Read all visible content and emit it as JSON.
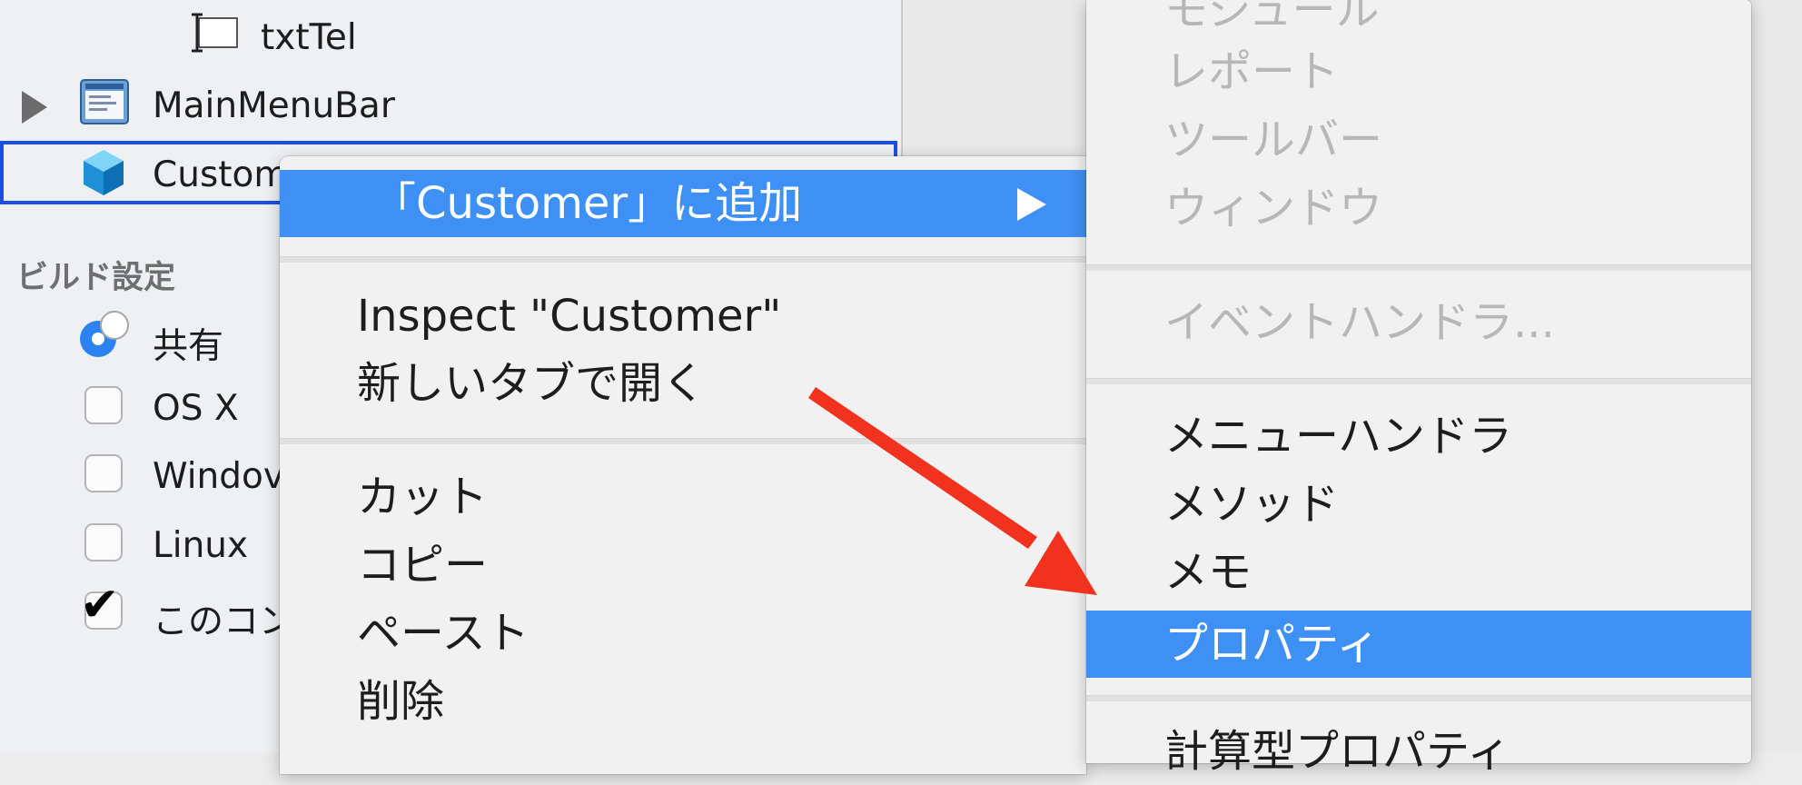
{
  "sidebar": {
    "tree": [
      {
        "label": "txtTel"
      },
      {
        "label": "MainMenuBar"
      },
      {
        "label": "Custom"
      }
    ],
    "build_settings": {
      "title": "ビルド設定",
      "shared_label": "共有",
      "targets": [
        {
          "label": "OS X",
          "checked": false
        },
        {
          "label": "Windov",
          "checked": false
        },
        {
          "label": "Linux",
          "checked": false
        },
        {
          "label": "このコン",
          "checked": true
        }
      ]
    }
  },
  "context_menu": {
    "add_to": "「Customer」に追加",
    "inspect": "Inspect \"Customer\"",
    "open_new_tab": "新しいタブで開く",
    "cut": "カット",
    "copy": "コピー",
    "paste": "ペースト",
    "delete": "削除"
  },
  "submenu": {
    "module": "モジュール",
    "report": "レポート",
    "toolbar": "ツールバー",
    "window": "ウィンドウ",
    "event_handler": "イベントハンドラ...",
    "menu_handler": "メニューハンドラ",
    "method": "メソッド",
    "note": "メモ",
    "property": "プロパティ",
    "computed_property": "計算型プロパティ"
  },
  "colors": {
    "highlight": "#3f90f5",
    "selection_border": "#1a50e6",
    "annotation_arrow": "#f0321e"
  }
}
